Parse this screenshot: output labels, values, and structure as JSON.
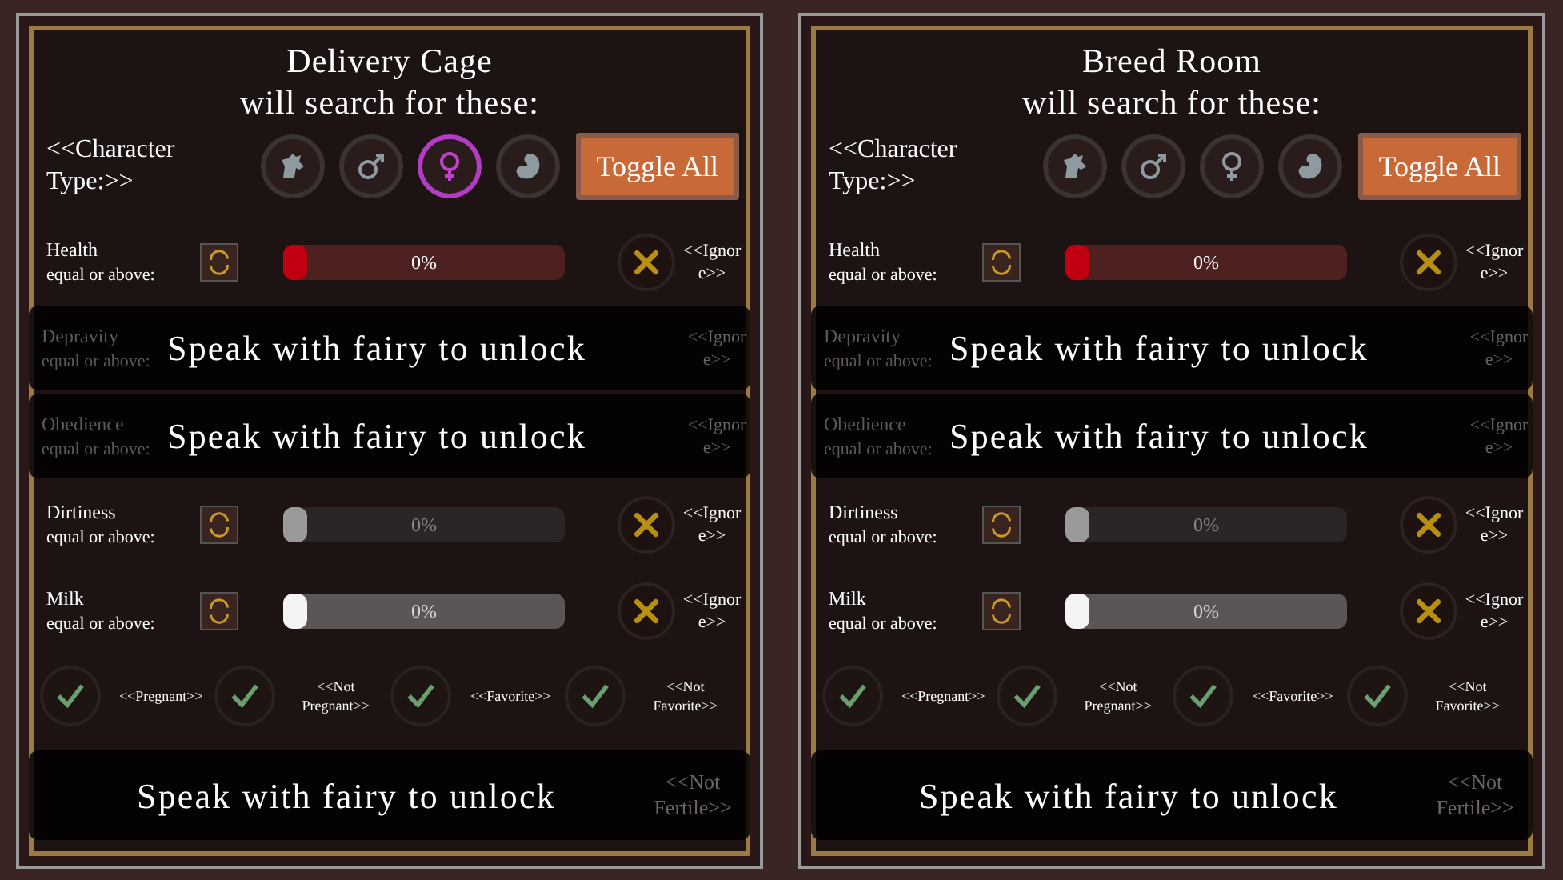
{
  "panels": [
    {
      "title": "Delivery Cage",
      "subtitle": "will search for these:",
      "type_label": "<<Character Type:>>",
      "types": [
        {
          "kind": "beast",
          "selected": false
        },
        {
          "kind": "male",
          "selected": false
        },
        {
          "kind": "female",
          "selected": true
        },
        {
          "kind": "embryo",
          "selected": false
        }
      ],
      "toggle_button": "Toggle All",
      "rows": [
        {
          "kind": "slider",
          "label": "Health",
          "sub": "equal or above:",
          "level": 0,
          "reading": "0%",
          "color": "#c00010",
          "ignore": "<<Ignore>>"
        },
        {
          "kind": "locked",
          "label": "Depravity",
          "sub": "equal or above:",
          "message": "Speak with fairy to unlock",
          "ignore": "<<Ignore>>"
        },
        {
          "kind": "locked",
          "label": "Obedience",
          "sub": "equal or above:",
          "message": "Speak with fairy to unlock",
          "ignore": "<<Ignore>>"
        },
        {
          "kind": "slider",
          "label": "Dirtiness",
          "sub": "equal or above:",
          "level": 0,
          "reading": "0%",
          "color": "#9a9a9a",
          "ignore": "<<Ignore>>"
        },
        {
          "kind": "slider",
          "label": "Milk",
          "sub": "equal or above:",
          "level": 0,
          "reading": "0%",
          "color": "#f4f4f4",
          "ignore": "<<Ignore>>"
        }
      ],
      "filters": [
        {
          "label": "<<Pregnant>>",
          "checked": true
        },
        {
          "label": "<<Not Pregnant>>",
          "checked": true
        },
        {
          "label": "<<Favorite>>",
          "checked": true
        },
        {
          "label": "<<Not Favorite>>",
          "checked": true
        }
      ],
      "locked_filters": {
        "message": "Speak with fairy to unlock",
        "last_label": "<<Not Fertile>>"
      }
    },
    {
      "title": "Breed Room",
      "subtitle": "will search for these:",
      "type_label": "<<Character Type:>>",
      "types": [
        {
          "kind": "beast",
          "selected": false
        },
        {
          "kind": "male",
          "selected": false
        },
        {
          "kind": "female",
          "selected": false
        },
        {
          "kind": "embryo",
          "selected": false
        }
      ],
      "toggle_button": "Toggle All",
      "rows": [
        {
          "kind": "slider",
          "label": "Health",
          "sub": "equal or above:",
          "level": 0,
          "reading": "0%",
          "color": "#c00010",
          "ignore": "<<Ignore>>"
        },
        {
          "kind": "locked",
          "label": "Depravity",
          "sub": "equal or above:",
          "message": "Speak with fairy to unlock",
          "ignore": "<<Ignore>>"
        },
        {
          "kind": "locked",
          "label": "Obedience",
          "sub": "equal or above:",
          "message": "Speak with fairy to unlock",
          "ignore": "<<Ignore>>"
        },
        {
          "kind": "slider",
          "label": "Dirtiness",
          "sub": "equal or above:",
          "level": 0,
          "reading": "0%",
          "color": "#9a9a9a",
          "ignore": "<<Ignore>>"
        },
        {
          "kind": "slider",
          "label": "Milk",
          "sub": "equal or above:",
          "level": 0,
          "reading": "0%",
          "color": "#f4f4f4",
          "ignore": "<<Ignore>>"
        }
      ],
      "filters": [
        {
          "label": "<<Pregnant>>",
          "checked": true
        },
        {
          "label": "<<Not Pregnant>>",
          "checked": true
        },
        {
          "label": "<<Favorite>>",
          "checked": true
        },
        {
          "label": "<<Not Favorite>>",
          "checked": true
        }
      ],
      "locked_filters": {
        "message": "Speak with fairy to unlock",
        "last_label": "<<Not Fertile>>"
      }
    }
  ]
}
